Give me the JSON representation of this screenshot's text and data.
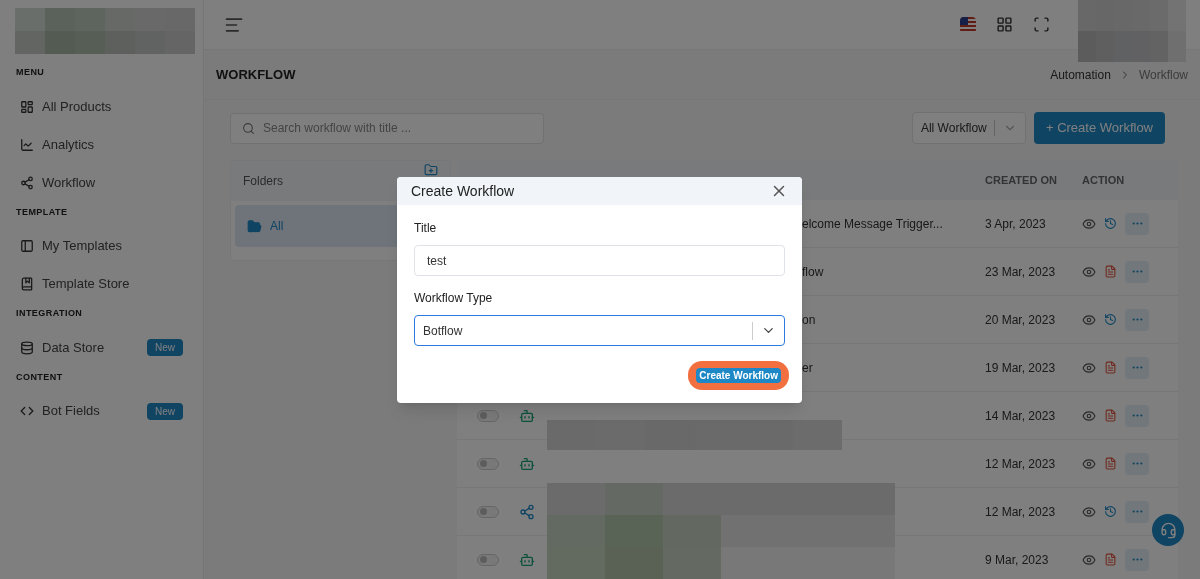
{
  "sidebar": {
    "sections": [
      {
        "heading": "MENU",
        "items": [
          {
            "label": "All Products"
          },
          {
            "label": "Analytics"
          },
          {
            "label": "Workflow"
          }
        ]
      },
      {
        "heading": "TEMPLATE",
        "items": [
          {
            "label": "My Templates"
          },
          {
            "label": "Template Store"
          }
        ]
      },
      {
        "heading": "INTEGRATION",
        "items": [
          {
            "label": "Data Store",
            "badge": "New"
          }
        ]
      },
      {
        "heading": "CONTENT",
        "items": [
          {
            "label": "Bot Fields",
            "badge": "New"
          }
        ]
      }
    ]
  },
  "page": {
    "title": "WORKFLOW",
    "breadcrumb": [
      {
        "label": "Automation",
        "current": false
      },
      {
        "label": "Workflow",
        "current": true
      }
    ]
  },
  "search": {
    "placeholder": "Search workflow with title ..."
  },
  "filter": {
    "value": "All Workflow"
  },
  "create_button": "+ Create Workflow",
  "folders": {
    "heading": "Folders",
    "items": [
      {
        "label": "All",
        "selected": true
      }
    ]
  },
  "table": {
    "columns": [
      "CREATED ON",
      "ACTION"
    ],
    "rows": [
      {
        "name": "elcome Message Trigger...",
        "created": "3 Apr, 2023",
        "actions": [
          {
            "kind": "view"
          },
          {
            "kind": "history"
          },
          {
            "kind": "more"
          }
        ]
      },
      {
        "name": "flow",
        "created": "23 Mar, 2023",
        "actions": [
          {
            "kind": "view"
          },
          {
            "kind": "document"
          },
          {
            "kind": "more"
          }
        ]
      },
      {
        "name": "on",
        "created": "20 Mar, 2023",
        "actions": [
          {
            "kind": "view"
          },
          {
            "kind": "history"
          },
          {
            "kind": "more"
          }
        ]
      },
      {
        "name": "er",
        "created": "19 Mar, 2023",
        "actions": [
          {
            "kind": "view"
          },
          {
            "kind": "document"
          },
          {
            "kind": "more"
          }
        ]
      },
      {
        "kind": "bot",
        "on": false,
        "created": "14 Mar, 2023",
        "actions": [
          {
            "kind": "view"
          },
          {
            "kind": "document"
          },
          {
            "kind": "more"
          }
        ]
      },
      {
        "kind": "bot",
        "on": false,
        "created": "12 Mar, 2023",
        "actions": [
          {
            "kind": "view"
          },
          {
            "kind": "document"
          },
          {
            "kind": "more"
          }
        ]
      },
      {
        "kind": "flow",
        "on": false,
        "created": "12 Mar, 2023",
        "actions": [
          {
            "kind": "view"
          },
          {
            "kind": "history"
          },
          {
            "kind": "more"
          }
        ]
      },
      {
        "kind": "bot",
        "on": false,
        "created": "9 Mar, 2023",
        "actions": [
          {
            "kind": "view"
          },
          {
            "kind": "document"
          },
          {
            "kind": "more"
          }
        ]
      }
    ]
  },
  "dialog": {
    "title": "Create Workflow",
    "fields": [
      {
        "label": "Title",
        "kind": "text",
        "value": "test",
        "focused": false
      },
      {
        "label": "Workflow Type",
        "kind": "select",
        "value": "Botflow",
        "focused": true
      }
    ],
    "submit": "Create Workflow",
    "submit_highlighted": true
  }
}
